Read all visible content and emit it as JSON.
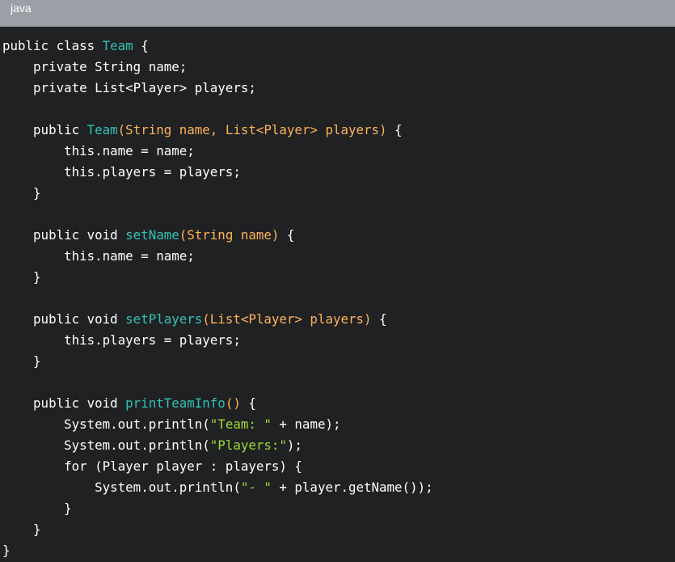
{
  "header": {
    "language": "java"
  },
  "colors": {
    "background": "#202123",
    "header_bar": "#9aa0a6",
    "keyword": "#ffffff",
    "type_name": "#2ec4b6",
    "function_name": "#2ec4b6",
    "parameters": "#ffb454",
    "string": "#9cdc2e"
  },
  "code": [
    [
      [
        "kw",
        "public class "
      ],
      [
        "type",
        "Team"
      ],
      [
        "plain",
        " {"
      ]
    ],
    [
      [
        "plain",
        "    private String name;"
      ]
    ],
    [
      [
        "plain",
        "    private List<Player> players;"
      ]
    ],
    [],
    [
      [
        "plain",
        "    public "
      ],
      [
        "func",
        "Team"
      ],
      [
        "paren",
        "(String name, List<Player> players)"
      ],
      [
        "plain",
        " {"
      ]
    ],
    [
      [
        "plain",
        "        this.name = name;"
      ]
    ],
    [
      [
        "plain",
        "        this.players = players;"
      ]
    ],
    [
      [
        "plain",
        "    }"
      ]
    ],
    [],
    [
      [
        "plain",
        "    public void "
      ],
      [
        "func",
        "setName"
      ],
      [
        "paren",
        "(String name)"
      ],
      [
        "plain",
        " {"
      ]
    ],
    [
      [
        "plain",
        "        this.name = name;"
      ]
    ],
    [
      [
        "plain",
        "    }"
      ]
    ],
    [],
    [
      [
        "plain",
        "    public void "
      ],
      [
        "func",
        "setPlayers"
      ],
      [
        "paren",
        "(List<Player> players)"
      ],
      [
        "plain",
        " {"
      ]
    ],
    [
      [
        "plain",
        "        this.players = players;"
      ]
    ],
    [
      [
        "plain",
        "    }"
      ]
    ],
    [],
    [
      [
        "plain",
        "    public void "
      ],
      [
        "func",
        "printTeamInfo"
      ],
      [
        "paren",
        "()"
      ],
      [
        "plain",
        " {"
      ]
    ],
    [
      [
        "plain",
        "        System.out.println("
      ],
      [
        "str",
        "\"Team: \""
      ],
      [
        "plain",
        " + name);"
      ]
    ],
    [
      [
        "plain",
        "        System.out.println("
      ],
      [
        "str",
        "\"Players:\""
      ],
      [
        "plain",
        ");"
      ]
    ],
    [
      [
        "plain",
        "        for (Player player : players) {"
      ]
    ],
    [
      [
        "plain",
        "            System.out.println("
      ],
      [
        "str",
        "\"- \""
      ],
      [
        "plain",
        " + player.getName());"
      ]
    ],
    [
      [
        "plain",
        "        }"
      ]
    ],
    [
      [
        "plain",
        "    }"
      ]
    ],
    [
      [
        "plain",
        "}"
      ]
    ]
  ]
}
